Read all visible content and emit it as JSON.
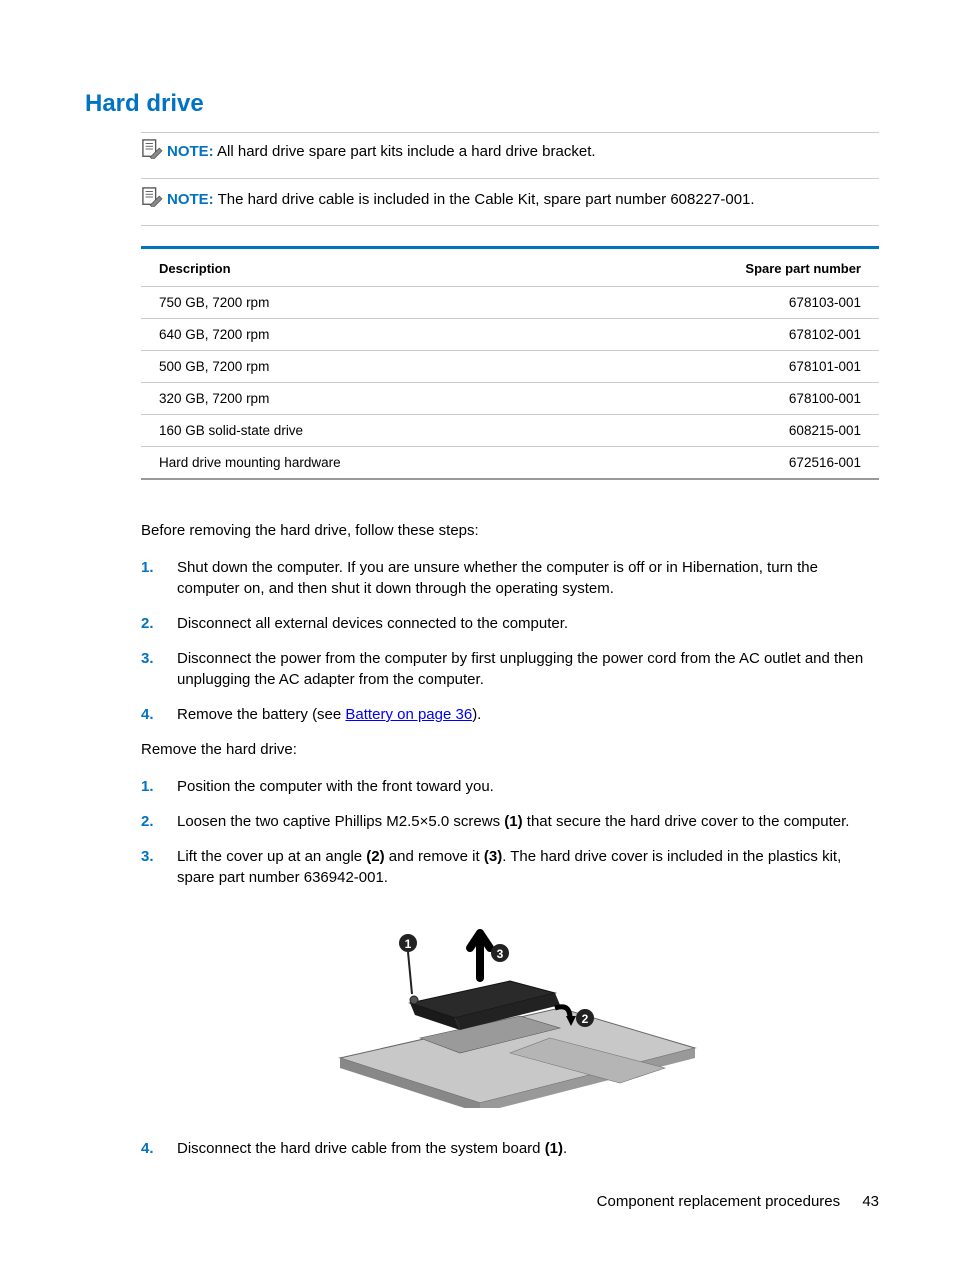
{
  "heading": "Hard drive",
  "notes": [
    {
      "label": "NOTE:",
      "text": "All hard drive spare part kits include a hard drive bracket."
    },
    {
      "label": "NOTE:",
      "text": "The hard drive cable is included in the Cable Kit, spare part number 608227-001."
    }
  ],
  "table": {
    "headers": {
      "c1": "Description",
      "c2": "Spare part number"
    },
    "rows": [
      {
        "c1": "750 GB, 7200 rpm",
        "c2": "678103-001"
      },
      {
        "c1": "640 GB, 7200 rpm",
        "c2": "678102-001"
      },
      {
        "c1": "500 GB, 7200 rpm",
        "c2": "678101-001"
      },
      {
        "c1": "320 GB, 7200 rpm",
        "c2": "678100-001"
      },
      {
        "c1": "160 GB solid-state drive",
        "c2": "608215-001"
      },
      {
        "c1": "Hard drive mounting hardware",
        "c2": "672516-001"
      }
    ]
  },
  "para1": "Before removing the hard drive, follow these steps:",
  "list1": [
    {
      "n": "1.",
      "text": "Shut down the computer. If you are unsure whether the computer is off or in Hibernation, turn the computer on, and then shut it down through the operating system."
    },
    {
      "n": "2.",
      "text": "Disconnect all external devices connected to the computer."
    },
    {
      "n": "3.",
      "text": "Disconnect the power from the computer by first unplugging the power cord from the AC outlet and then unplugging the AC adapter from the computer."
    }
  ],
  "list1_item4": {
    "n": "4.",
    "prefix": "Remove the battery (see ",
    "link": "Battery on page 36",
    "suffix": ")."
  },
  "para2": "Remove the hard drive:",
  "list2": [
    {
      "n": "1.",
      "text": "Position the computer with the front toward you."
    }
  ],
  "list2_item2": {
    "n": "2.",
    "p1": "Loosen the two captive Phillips M2.5×5.0 screws ",
    "b1": "(1)",
    "p2": " that secure the hard drive cover to the computer."
  },
  "list2_item3": {
    "n": "3.",
    "p1": "Lift the cover up at an angle ",
    "b1": "(2)",
    "p2": " and remove it ",
    "b2": "(3)",
    "p3": ". The hard drive cover is included in the plastics kit, spare part number 636942-001."
  },
  "list2_item4": {
    "n": "4.",
    "p1": "Disconnect the hard drive cable from the system board ",
    "b1": "(1)",
    "p2": "."
  },
  "footer": {
    "section": "Component replacement procedures",
    "page": "43"
  }
}
